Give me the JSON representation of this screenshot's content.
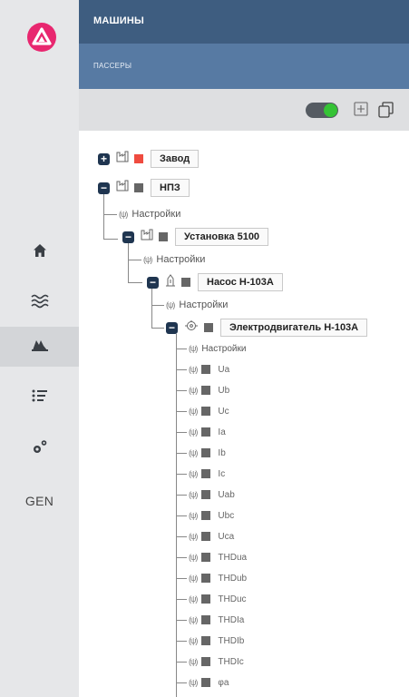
{
  "header": {
    "title": "МАШИНЫ",
    "subtitle": "ПАССЕРЫ"
  },
  "rail": {
    "gen_label": "GEN",
    "active_index": 2
  },
  "toolbar": {
    "toggle_on": true
  },
  "tree": {
    "root1": {
      "label": "Завод",
      "status_color": "#ef4b3f",
      "expanded": false
    },
    "root2": {
      "label": "НПЗ",
      "status_color": "#666666",
      "expanded": true
    },
    "settings_label": "Настройки",
    "unit": {
      "label": "Установка 5100"
    },
    "pump": {
      "label": "Насос Н-103А"
    },
    "motor": {
      "label": "Электродвигатель Н-103А"
    },
    "channels": [
      "Ua",
      "Ub",
      "Uc",
      "Ia",
      "Ib",
      "Ic",
      "Uab",
      "Ubc",
      "Uca",
      "THDua",
      "THDub",
      "THDuc",
      "THDIa",
      "THDIb",
      "THDIc",
      "φa"
    ]
  }
}
